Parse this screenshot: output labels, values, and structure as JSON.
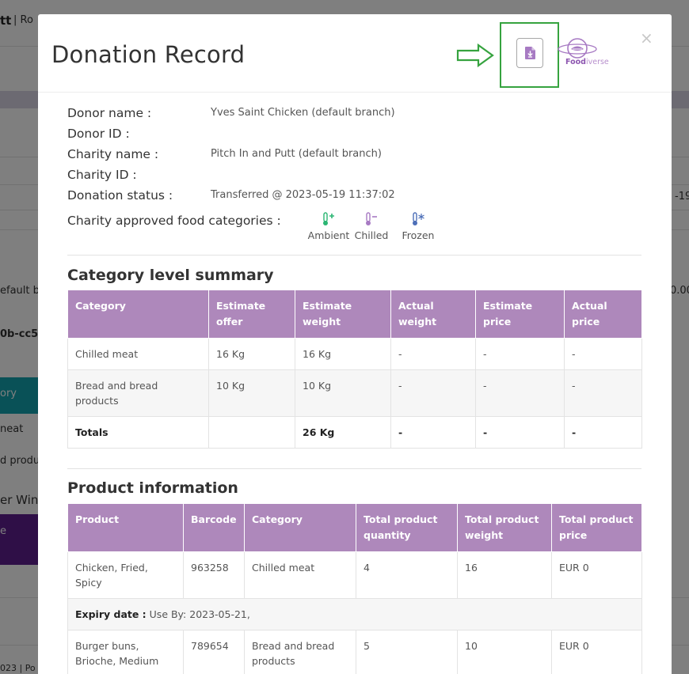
{
  "background": {
    "header_name": "tt",
    "header_role": "| Ro",
    "date_fragment": "-19",
    "default_fragment": "efault br",
    "amount_fragment": "0.00",
    "id_fragment": "0b-cc5",
    "teal_label": "ory",
    "meat_fragment": "neat",
    "produ_fragment": "d produ",
    "win_fragment": "er Wind",
    "purple_label": "e",
    "footer_fragment": "023 | Po"
  },
  "modal": {
    "title": "Donation Record",
    "export_button": {
      "icon": "file-download-icon"
    },
    "logo": {
      "text_part1": "Food",
      "text_part2": "iverse"
    },
    "close_label": "×",
    "fields": [
      {
        "label": "Donor name :",
        "value": "Yves Saint Chicken (default branch)"
      },
      {
        "label": "Donor ID :",
        "value": ""
      },
      {
        "label": "Charity name :",
        "value": "Pitch In and Putt (default branch)"
      },
      {
        "label": "Charity ID :",
        "value": ""
      },
      {
        "label": "Donation status :",
        "value": "Transferred @ 2023-05-19 11:37:02"
      }
    ],
    "categories": {
      "label": "Charity approved food categories :",
      "items": [
        {
          "name": "Ambient",
          "icon": "thermometer-plus-icon",
          "color": "#2bb673"
        },
        {
          "name": "Chilled",
          "icon": "thermometer-minus-icon",
          "color": "#a77ac3"
        },
        {
          "name": "Frozen",
          "icon": "thermometer-snowflake-icon",
          "color": "#4d6fb8"
        }
      ]
    },
    "category_summary": {
      "title": "Category level summary",
      "headers": [
        "Category",
        "Estimate offer",
        "Estimate weight",
        "Actual weight",
        "Estimate price",
        "Actual price"
      ],
      "rows": [
        [
          "Chilled meat",
          "16 Kg",
          "16 Kg",
          "-",
          "-",
          "-"
        ],
        [
          "Bread and bread products",
          "10 Kg",
          "10 Kg",
          "-",
          "-",
          "-"
        ]
      ],
      "totals": [
        "Totals",
        "",
        "26 Kg",
        "-",
        "-",
        "-"
      ]
    },
    "product_info": {
      "title": "Product information",
      "headers": [
        "Product",
        "Barcode",
        "Category",
        "Total product quantity",
        "Total product weight",
        "Total product price"
      ],
      "rows": [
        [
          "Chicken, Fried, Spicy",
          "963258",
          "Chilled meat",
          "4",
          "16",
          "EUR 0"
        ],
        [
          "Burger buns, Brioche, Medium",
          "789654",
          "Bread and bread products",
          "5",
          "10",
          "EUR 0"
        ]
      ],
      "expiry_label": "Expiry date :",
      "expiry_value": " Use By: 2023-05-21,"
    }
  },
  "colors": {
    "accent": "#ae88bb",
    "annotation": "#36a33f",
    "teal": "#13a2ae",
    "purple_dark": "#5e1e8f"
  }
}
